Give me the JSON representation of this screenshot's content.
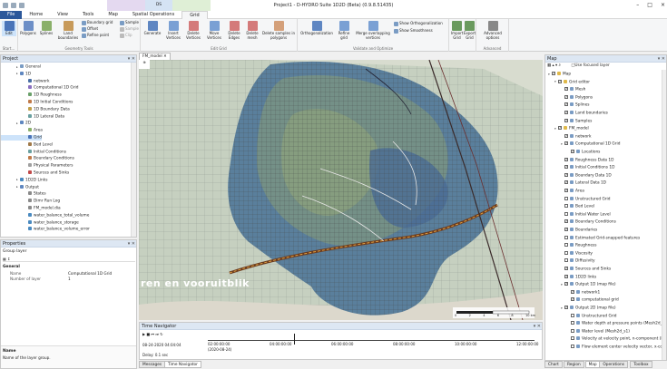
{
  "titlebar": {
    "title": "Project1 - D-HYDRO Suite 1D2D (Beta) (0.9.8.51435)",
    "context1": "DS",
    "context2": "Spatial Operations",
    "context3": "Grid"
  },
  "tabs": [
    "File",
    "Home",
    "View",
    "Tools",
    "Map",
    "Spatial Operations",
    "Grid"
  ],
  "ribbon": {
    "edit": "Edit",
    "start": "Start...",
    "polygons": "Polygons",
    "splines": "Splines",
    "land_boundaries": "Land boundaries",
    "boundary_grid": "Boundary grid",
    "offset": "Offset",
    "refine_point": "Refine point",
    "sample": "Sample",
    "sample_s2": "Sample",
    "clip": "Clip",
    "geometry_tools": "Geometry Tools",
    "generate": "Generate",
    "insert_vertices": "Insert Vertices",
    "delete_vertices": "Delete Vertices",
    "move_vertices": "Move Vertices",
    "delete_edges": "Delete Edges",
    "delete_mesh": "Delete mesh",
    "delete_samples": "Delete samples in polygons",
    "edit_grid": "Edit Grid",
    "orthogonalization": "Orthogonalization",
    "refine_grid": "Refine grid",
    "merge_overlapping": "Merge overlapping vertices",
    "show_ortho": "Show Orthogonalization",
    "show_smooth": "Show Smoothness",
    "validate": "Validate and Optimize",
    "import_grid": "Import Grid",
    "export_grid": "Export Grid",
    "advanced_options": "Advanced options",
    "advanced": "Advanced"
  },
  "project": {
    "title": "Project",
    "items": [
      "General",
      "1D",
      "network",
      "Computational 1D Grid",
      "1D Roughness",
      "1D Initial Conditions",
      "1D Boundary Data",
      "1D Lateral Data",
      "2D",
      "Area",
      "Grid",
      "Bed Level",
      "Initial Conditions",
      "Boundary Conditions",
      "Physical Parameters",
      "Sources and Sinks",
      "1D2D Links",
      "Output",
      "States",
      "Dimr Run Log",
      "FM_model.dia",
      "water_balance_total_volume",
      "water_balance_storage",
      "water_balance_volume_error"
    ]
  },
  "properties": {
    "title": "Properties",
    "header": "Group layer",
    "general": "General",
    "rows": [
      {
        "k": "Name",
        "v": "Computational 1D Grid"
      },
      {
        "k": "Number of layer",
        "v": "1"
      }
    ],
    "desc_title": "Name",
    "desc": "Name of the layer group."
  },
  "map": {
    "tab": "FM_model",
    "overlay": "ren en vooruitblik",
    "scale": [
      "0",
      "2",
      "4",
      "6",
      "8",
      "10 km"
    ]
  },
  "time": {
    "title": "Time Navigator",
    "timestamp": "08-24-2020 04:04:04",
    "delay_label": "Delay:",
    "delay": "0.1",
    "unit": "sec",
    "ticks": [
      "02:00:00:00",
      "04:00:00:00",
      "06:00:00:00",
      "08:00:00:00",
      "10:00:00:00",
      "12:00:00:00"
    ],
    "date": "(2020-08-24)"
  },
  "bottom_tabs": [
    "Messages",
    "Time Navigator"
  ],
  "mapPanel": {
    "title": "Map",
    "use_focused": "Use focused layer",
    "layers": [
      {
        "t": "Map",
        "lv": 0
      },
      {
        "t": "Grid editor",
        "lv": 1
      },
      {
        "t": "Mesh",
        "lv": 2
      },
      {
        "t": "Polygons",
        "lv": 2
      },
      {
        "t": "Splines",
        "lv": 2
      },
      {
        "t": "Land boundaries",
        "lv": 2
      },
      {
        "t": "Samples",
        "lv": 2
      },
      {
        "t": "FM_model",
        "lv": 1
      },
      {
        "t": "network",
        "lv": 2
      },
      {
        "t": "Computational 1D Grid",
        "lv": 2
      },
      {
        "t": "Locations",
        "lv": 3
      },
      {
        "t": "Roughness Data 1D",
        "lv": 2
      },
      {
        "t": "Initial Conditions 1D",
        "lv": 2
      },
      {
        "t": "Boundary Data 1D",
        "lv": 2
      },
      {
        "t": "Lateral Data 1D",
        "lv": 2
      },
      {
        "t": "Area",
        "lv": 2
      },
      {
        "t": "Unstructured Grid",
        "lv": 2
      },
      {
        "t": "Bed Level",
        "lv": 2
      },
      {
        "t": "Initial Water Level",
        "lv": 2
      },
      {
        "t": "Boundary Conditions",
        "lv": 2
      },
      {
        "t": "Boundaries",
        "lv": 2
      },
      {
        "t": "Estimated Grid-snapped features",
        "lv": 2
      },
      {
        "t": "Roughness",
        "lv": 2
      },
      {
        "t": "Viscosity",
        "lv": 2
      },
      {
        "t": "Diffusivity",
        "lv": 2
      },
      {
        "t": "Sources and Sinks",
        "lv": 2
      },
      {
        "t": "1D2D links",
        "lv": 2
      },
      {
        "t": "Output 1D (map file)",
        "lv": 2
      },
      {
        "t": "network1",
        "lv": 3
      },
      {
        "t": "computational grid",
        "lv": 3
      },
      {
        "t": "Output 2D (map file)",
        "lv": 2
      },
      {
        "t": "Unstructured Grid",
        "lv": 3
      },
      {
        "t": "Water depth at pressure points (Mesh2d_wa",
        "lv": 3
      },
      {
        "t": "Water level (Mesh2d_s1)",
        "lv": 3
      },
      {
        "t": "Velocity at velocity point, n-component (Me",
        "lv": 3
      },
      {
        "t": "Flow element center velocity vector, x-comp",
        "lv": 3
      }
    ]
  },
  "right_tabs": [
    "Chart",
    "Region",
    "Map",
    "Operations",
    "Toolbox"
  ]
}
